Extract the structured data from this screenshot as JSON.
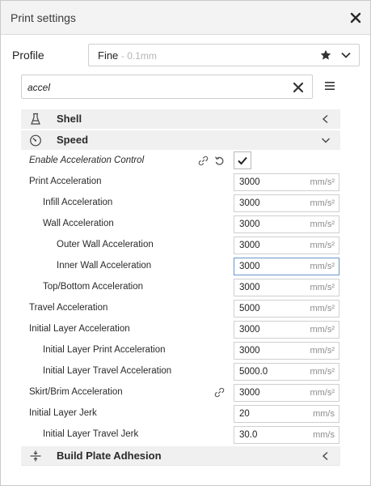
{
  "window": {
    "title": "Print settings"
  },
  "profile": {
    "label": "Profile",
    "name": "Fine",
    "sub": "- 0.1mm"
  },
  "search": {
    "value": "accel"
  },
  "categories": [
    {
      "label": "Shell",
      "icon": "shell-icon",
      "state": "collapsed"
    },
    {
      "label": "Speed",
      "icon": "speed-icon",
      "state": "expanded"
    },
    {
      "label": "Build Plate Adhesion",
      "icon": "adhesion-icon",
      "state": "collapsed"
    }
  ],
  "settings": [
    {
      "label": "Enable Acceleration Control",
      "type": "checkbox",
      "checked": true
    },
    {
      "label": "Print Acceleration",
      "value": "3000",
      "unit": "mm/s²"
    },
    {
      "label": "Infill Acceleration",
      "value": "3000",
      "unit": "mm/s²"
    },
    {
      "label": "Wall Acceleration",
      "value": "3000",
      "unit": "mm/s²"
    },
    {
      "label": "Outer Wall Acceleration",
      "value": "3000",
      "unit": "mm/s²"
    },
    {
      "label": "Inner Wall Acceleration",
      "value": "3000",
      "unit": "mm/s²",
      "focused": true
    },
    {
      "label": "Top/Bottom Acceleration",
      "value": "3000",
      "unit": "mm/s²"
    },
    {
      "label": "Travel Acceleration",
      "value": "5000",
      "unit": "mm/s²"
    },
    {
      "label": "Initial Layer Acceleration",
      "value": "3000",
      "unit": "mm/s²"
    },
    {
      "label": "Initial Layer Print Acceleration",
      "value": "3000",
      "unit": "mm/s²"
    },
    {
      "label": "Initial Layer Travel Acceleration",
      "value": "5000.0",
      "unit": "mm/s²"
    },
    {
      "label": "Skirt/Brim Acceleration",
      "value": "3000",
      "unit": "mm/s²"
    },
    {
      "label": "Initial Layer Jerk",
      "value": "20",
      "unit": "mm/s"
    },
    {
      "label": "Initial Layer Travel Jerk",
      "value": "30.0",
      "unit": "mm/s"
    }
  ]
}
